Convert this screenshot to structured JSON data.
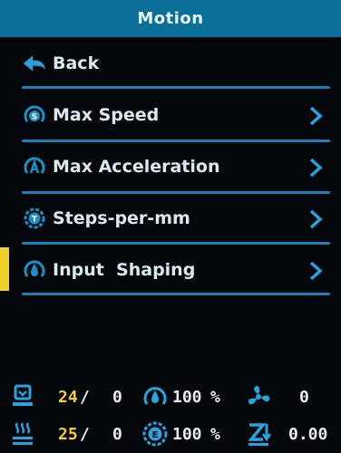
{
  "title": "Motion",
  "menu": {
    "back_label": "Back",
    "items": [
      {
        "label": "Max Speed",
        "icon": "speed-icon"
      },
      {
        "label": "Max Acceleration",
        "icon": "acceleration-icon"
      },
      {
        "label": "Steps-per-mm",
        "icon": "steps-icon"
      },
      {
        "label": "Input  Shaping",
        "icon": "input-shaping-icon",
        "selected": true
      }
    ]
  },
  "status": {
    "bed_temp_current": "24",
    "bed_temp_sep": "/",
    "bed_temp_target": "0",
    "speed_percent": "100",
    "speed_unit": "%",
    "fan_value": "0",
    "hotend_temp_current": "25",
    "hotend_temp_sep": "/",
    "hotend_temp_target": "0",
    "extrusion_percent": "100",
    "extrusion_unit": "%",
    "z_value": "0.00"
  },
  "colors": {
    "title_bg": "#0a6f96",
    "accent": "#1582b3",
    "selection": "#f0d12a",
    "value_yellow": "#f2cf2e"
  }
}
